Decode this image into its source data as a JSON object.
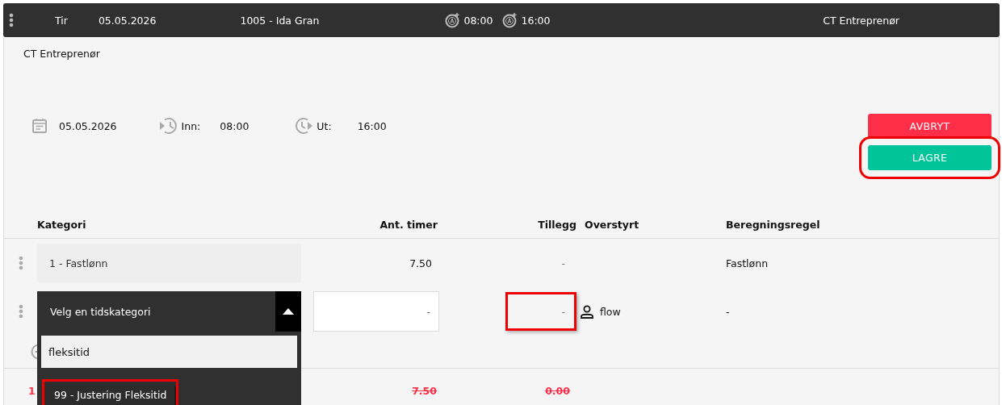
{
  "top_bar": {
    "day": "Tir",
    "date": "05.05.2026",
    "employee": "1005 - Ida Gran",
    "clock_in": "08:00",
    "clock_out": "16:00",
    "company": "CT Entreprenør"
  },
  "department": "CT Entreprenør",
  "shift": {
    "date": "05.05.2026",
    "in_label": "Inn:",
    "in_time": "08:00",
    "out_label": "Ut:",
    "out_time": "16:00"
  },
  "buttons": [
    {
      "label": "AVBRYT",
      "kind": "cancel",
      "highlighted": false
    },
    {
      "label": "LAGRE",
      "kind": "save",
      "highlighted": true
    }
  ],
  "table": {
    "columns": [
      "Kategori",
      "Ant. timer",
      "Tillegg",
      "Overstyrt",
      "Beregningsregel"
    ],
    "rows": [
      {
        "kind": "static",
        "category": "1 - Fastlønn",
        "hours": "7.50",
        "supplement": "-",
        "supplement_highlighted": false,
        "rule": "Fastlønn"
      },
      {
        "kind": "editing",
        "category_placeholder": "Velg en tidskategori",
        "expanded": true,
        "hours_placeholder": "-",
        "supplement": "-",
        "supplement_highlighted": true,
        "override_user": "flow",
        "rule": "-",
        "search": "fleksitid",
        "options": [
          {
            "label": "99 - Justering Fleksitid",
            "highlighted": true
          }
        ]
      }
    ],
    "totals": {
      "label": "1",
      "hours": "7.50",
      "supplement": "0.00"
    }
  }
}
